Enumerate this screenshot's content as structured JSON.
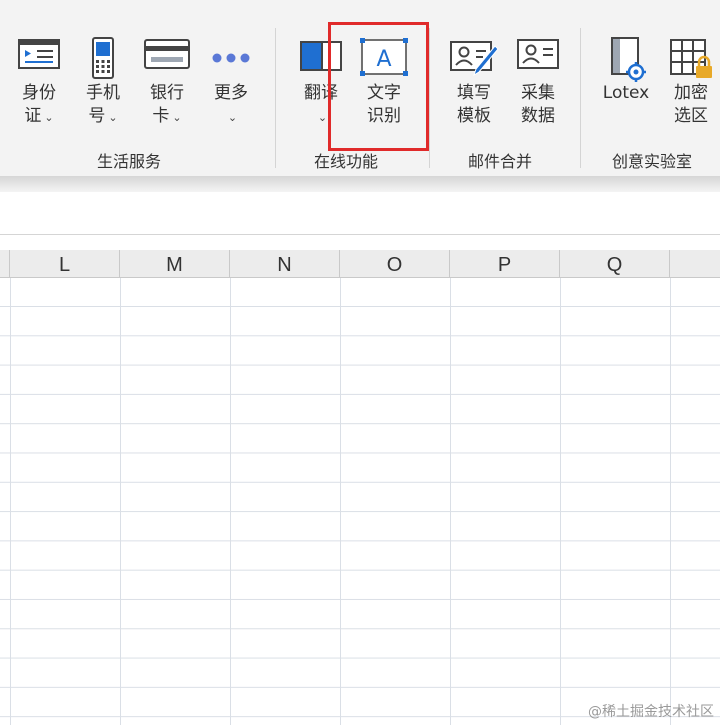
{
  "ribbon": {
    "groups": [
      {
        "label": "生活服务",
        "buttons": [
          {
            "line1": "身份",
            "line2": "证",
            "icon": "id-card-icon"
          },
          {
            "line1": "手机",
            "line2": "号",
            "icon": "mobile-phone-icon"
          },
          {
            "line1": "银行",
            "line2": "卡",
            "icon": "bank-card-icon"
          },
          {
            "line1": "更多",
            "line2": "",
            "icon": "more-dots-icon"
          }
        ]
      },
      {
        "label": "在线功能",
        "buttons": [
          {
            "line1": "翻译",
            "line2": "",
            "icon": "translate-icon"
          },
          {
            "line1": "文字",
            "line2": "识别",
            "icon": "text-recognition-icon"
          }
        ]
      },
      {
        "label": "邮件合并",
        "buttons": [
          {
            "line1": "填写",
            "line2": "模板",
            "icon": "fill-template-icon"
          },
          {
            "line1": "采集",
            "line2": "数据",
            "icon": "collect-data-icon"
          }
        ]
      },
      {
        "label": "创意实验室",
        "buttons": [
          {
            "line1": "Lotex",
            "line2": "",
            "icon": "lotex-icon"
          },
          {
            "line1": "加密",
            "line2": "选区",
            "icon": "encrypt-selection-icon"
          }
        ]
      }
    ]
  },
  "grid": {
    "columns": [
      "L",
      "M",
      "N",
      "O",
      "P",
      "Q"
    ]
  },
  "watermark": "@稀土掘金技术社区",
  "colors": {
    "highlight": "#e02a2a",
    "accent_blue": "#1f6fd1",
    "dots": "#5a78d6"
  }
}
